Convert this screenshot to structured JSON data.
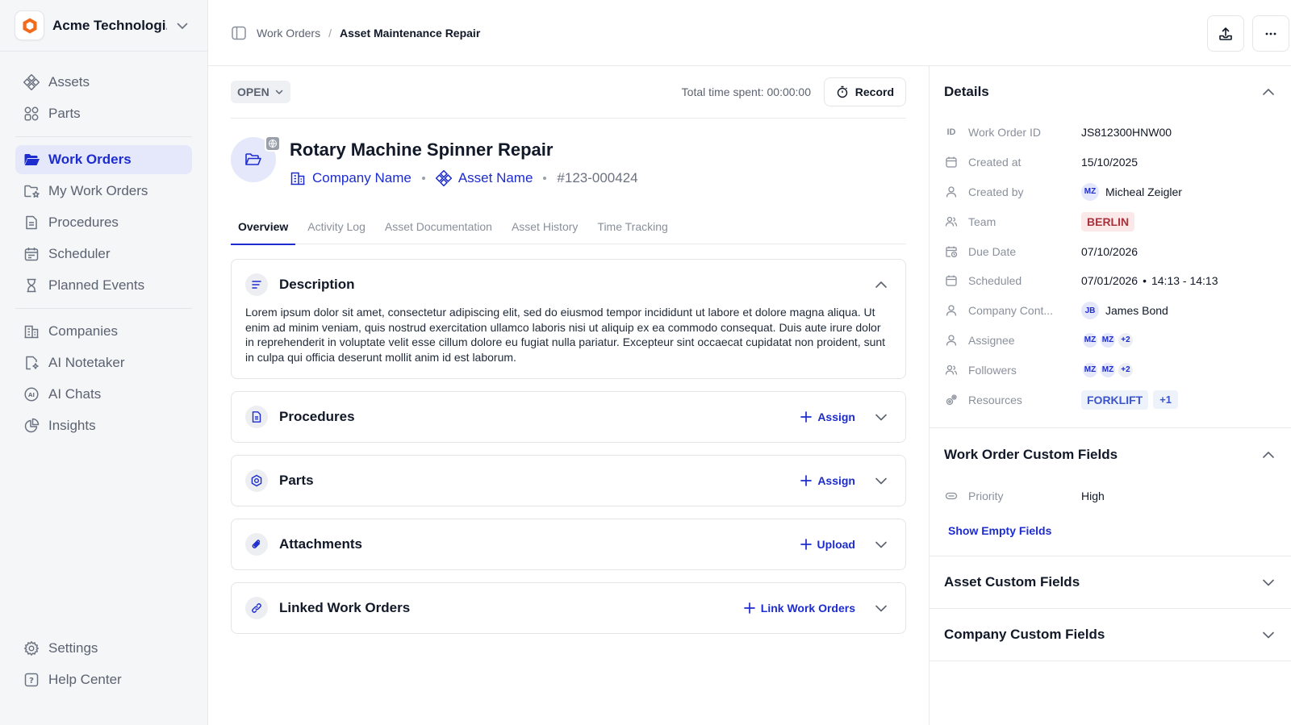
{
  "org": {
    "name": "Acme Technologi...",
    "brand_color": "#f26b1d"
  },
  "sidebar": {
    "group1": [
      {
        "label": "Assets",
        "icon": "assets-icon"
      },
      {
        "label": "Parts",
        "icon": "parts-icon"
      }
    ],
    "group2": [
      {
        "label": "Work Orders",
        "icon": "folder-open-icon",
        "active": true
      },
      {
        "label": "My Work Orders",
        "icon": "folder-star-icon"
      },
      {
        "label": "Procedures",
        "icon": "document-icon"
      },
      {
        "label": "Scheduler",
        "icon": "calendar-icon"
      },
      {
        "label": "Planned Events",
        "icon": "hourglass-icon"
      }
    ],
    "group3": [
      {
        "label": "Companies",
        "icon": "building-icon"
      },
      {
        "label": "AI Notetaker",
        "icon": "note-icon"
      },
      {
        "label": "AI Chats",
        "icon": "ai-chat-icon"
      },
      {
        "label": "Insights",
        "icon": "pie-chart-icon"
      }
    ],
    "bottom": [
      {
        "label": "Settings",
        "icon": "gear-icon"
      },
      {
        "label": "Help Center",
        "icon": "help-icon"
      }
    ]
  },
  "breadcrumb": {
    "parent": "Work Orders",
    "separator": "/",
    "current": "Asset Maintenance Repair"
  },
  "status": {
    "label": "OPEN",
    "time_spent": "Total time spent: 00:00:00",
    "record_label": "Record"
  },
  "work_order": {
    "title": "Rotary Machine Spinner Repair",
    "company": "Company Name",
    "asset": "Asset Name",
    "id": "#123-000424"
  },
  "tabs": [
    "Overview",
    "Activity Log",
    "Asset Documentation",
    "Asset History",
    "Time Tracking"
  ],
  "description": {
    "title": "Description",
    "text": "Lorem ipsum dolor sit amet, consectetur adipiscing elit, sed do eiusmod tempor incididunt ut labore et dolore magna aliqua. Ut enim ad minim veniam, quis nostrud exercitation ullamco laboris nisi ut aliquip ex ea commodo consequat. Duis aute irure dolor in reprehenderit in voluptate velit esse cillum dolore eu fugiat nulla pariatur. Excepteur sint occaecat cupidatat non proident, sunt in culpa qui officia deserunt mollit anim id est laborum."
  },
  "sections": [
    {
      "title": "Procedures",
      "action": "Assign"
    },
    {
      "title": "Parts",
      "action": "Assign"
    },
    {
      "title": "Attachments",
      "action": "Upload"
    },
    {
      "title": "Linked Work Orders",
      "action": "Link Work Orders"
    }
  ],
  "details": {
    "title": "Details",
    "work_order_id_label": "Work Order ID",
    "work_order_id_icon_text": "ID",
    "work_order_id": "JS812300HNW00",
    "created_at_label": "Created at",
    "created_at": "15/10/2025",
    "created_by_label": "Created by",
    "created_by_initials": "MZ",
    "created_by": "Micheal Zeigler",
    "team_label": "Team",
    "team": "BERLIN",
    "due_date_label": "Due Date",
    "due_date": "07/10/2026",
    "scheduled_label": "Scheduled",
    "scheduled_date": "07/01/2026",
    "scheduled_sep": "•",
    "scheduled_time": "14:13 - 14:13",
    "company_contact_label": "Company Cont...",
    "company_contact_initials": "JB",
    "company_contact": "James Bond",
    "assignee_label": "Assignee",
    "assignee_a": "MZ",
    "assignee_b": "MZ",
    "assignee_more": "+2",
    "followers_label": "Followers",
    "followers_a": "MZ",
    "followers_b": "MZ",
    "followers_more": "+2",
    "resources_label": "Resources",
    "resource": "FORKLIFT",
    "resources_more": "+1"
  },
  "custom_fields": {
    "title": "Work Order Custom Fields",
    "priority_label": "Priority",
    "priority": "High",
    "show_empty": "Show Empty Fields"
  },
  "asset_custom_fields": {
    "title": "Asset Custom Fields"
  },
  "company_custom_fields": {
    "title": "Company Custom Fields"
  },
  "colors": {
    "accent": "#1d2ccf",
    "active_bg": "#e5e8fb",
    "team_tag": "#a8323b",
    "sidebar_bg": "#f5f6f8"
  }
}
